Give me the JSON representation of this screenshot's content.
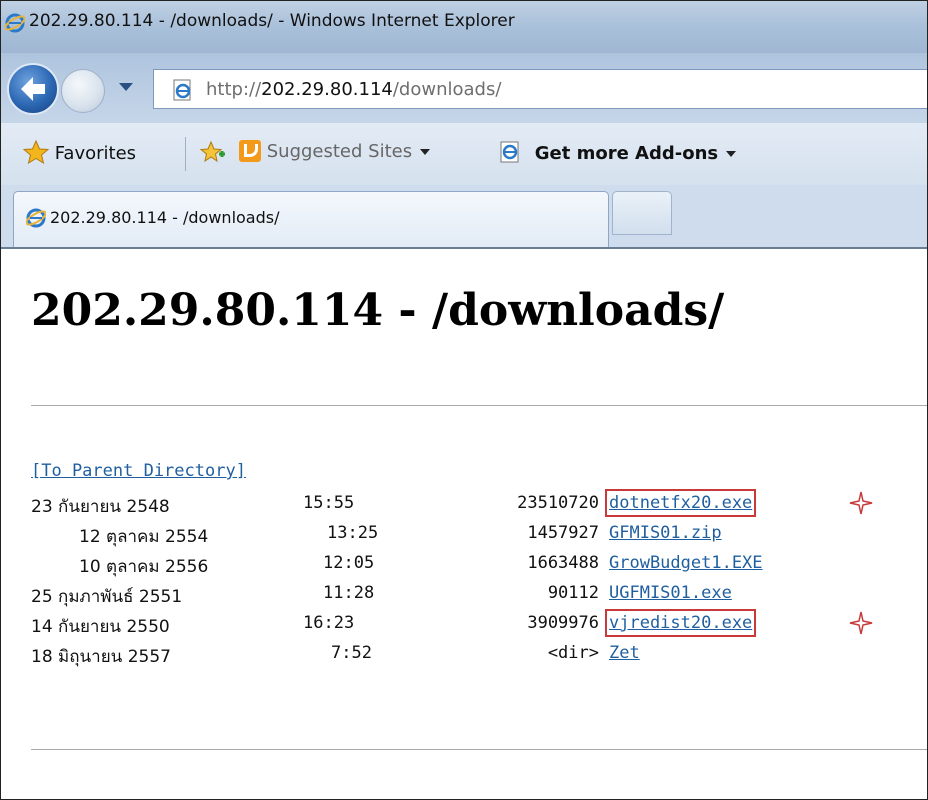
{
  "window": {
    "title": "202.29.80.114 - /downloads/ - Windows Internet Explorer",
    "address_prefix": "http://",
    "address_host": "202.29.80.114",
    "address_path": "/downloads/"
  },
  "favorites_bar": {
    "favorites_label": "Favorites",
    "suggested_sites_label": "Suggested Sites",
    "addons_label": "Get more Add-ons"
  },
  "tab": {
    "label": "202.29.80.114 - /downloads/"
  },
  "page": {
    "title": "202.29.80.114 - /downloads/",
    "parent_link": "[To Parent Directory]",
    "entries": [
      {
        "date": "23 กันยายน 2548",
        "time": "15:55",
        "size": "23510720",
        "name": "dotnetfx20.exe",
        "highlighted": true
      },
      {
        "date": "12 ตุลาคม 2554",
        "time": "13:25",
        "size": "1457927",
        "name": "GFMIS01.zip",
        "highlighted": false
      },
      {
        "date": "10 ตุลาคม 2556",
        "time": "12:05",
        "size": "1663488",
        "name": "GrowBudget1.EXE",
        "highlighted": false
      },
      {
        "date": "25 กุมภาพันธ์ 2551",
        "time": "11:28",
        "size": "90112",
        "name": "UGFMIS01.exe",
        "highlighted": false
      },
      {
        "date": "14 กันยายน 2550",
        "time": "16:23",
        "size": "3909976",
        "name": "vjredist20.exe",
        "highlighted": true
      },
      {
        "date": "18 มิถุนายน 2557",
        "time": "7:52",
        "size": "<dir>",
        "name": "Zet",
        "highlighted": false
      }
    ]
  },
  "colors": {
    "link": "#1f5f9f",
    "highlight_box": "#c83a3a",
    "chrome": "#bfd0e3"
  },
  "icons": [
    "ie-icon",
    "back-arrow-icon",
    "forward-icon",
    "page-icon",
    "favorites-star-icon",
    "add-favorites-icon",
    "suggested-sites-icon",
    "addons-icon",
    "marker-star-icon"
  ]
}
